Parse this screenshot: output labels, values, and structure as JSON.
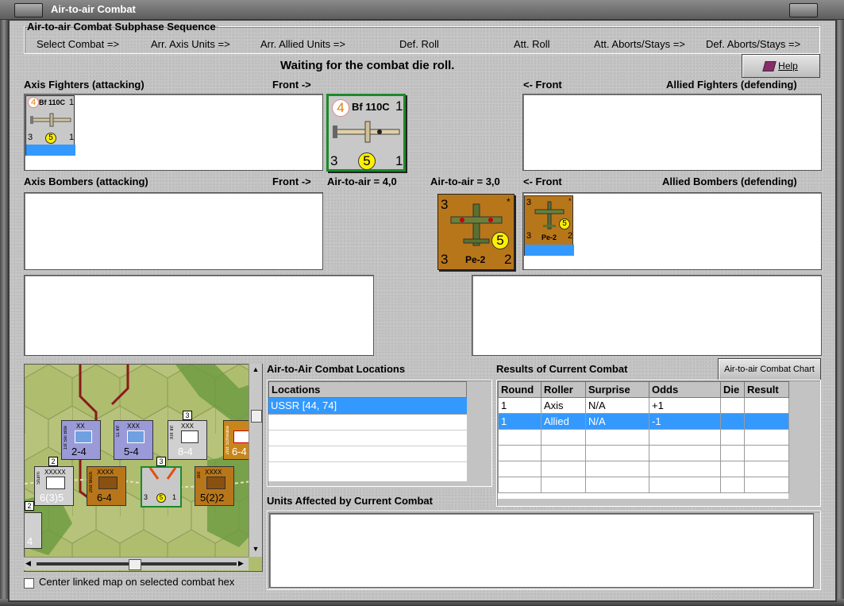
{
  "window": {
    "title": "Air-to-air Combat"
  },
  "sequence": {
    "title": "Air-to-air Combat Subphase Sequence",
    "steps": [
      "Select Combat =>",
      "Arr. Axis Units =>",
      "Arr. Allied Units =>",
      "Def. Roll",
      "Att. Roll",
      "Att. Aborts/Stays =>",
      "Def. Aborts/Stays =>"
    ]
  },
  "status_message": "Waiting for the combat die roll.",
  "help_label": "Help",
  "axis_fighters": {
    "label": "Axis Fighters (attacking)",
    "front": "Front ->"
  },
  "allied_fighters": {
    "label": "Allied Fighters (defending)",
    "front": "<- Front"
  },
  "axis_bombers": {
    "label": "Axis Bombers (attacking)",
    "front": "Front ->",
    "air_to_air": "Air-to-air = 4,0"
  },
  "allied_bombers": {
    "label": "Allied Bombers (defending)",
    "front": "<- Front",
    "air_to_air": "Air-to-air = 3,0"
  },
  "bf110": {
    "name": "Bf 110C",
    "top_left": "4",
    "top_right": "1",
    "bottom_left": "3",
    "bottom_center": "5",
    "bottom_right": "1"
  },
  "pe2": {
    "name": "Pe-2",
    "top_left": "3",
    "star": "*",
    "center": "5",
    "bottom_left": "3",
    "bottom_right": "2"
  },
  "locations": {
    "title": "Air-to-Air Combat Locations",
    "header": "Locations",
    "rows": [
      "USSR [44, 74]"
    ]
  },
  "results": {
    "title": "Results of Current Combat",
    "chart_button": "Air-to-air Combat Chart",
    "columns": [
      "Round",
      "Roller",
      "Surprise",
      "Odds",
      "Die",
      "Result"
    ],
    "rows": [
      [
        "1",
        "Axis",
        "N/A",
        "+1",
        "",
        ""
      ],
      [
        "1",
        "Allied",
        "N/A",
        "-1",
        "",
        ""
      ]
    ]
  },
  "units_affected": {
    "title": "Units Affected by Current Combat"
  },
  "center_map": {
    "label": "Center linked map on selected combat hex"
  },
  "map_units": [
    {
      "type": "XX",
      "name": "1st Ski Bde",
      "value": "2-4"
    },
    {
      "type": "XXX",
      "name": "11 Inf",
      "value": "5-4"
    },
    {
      "type": "XXX",
      "name": "XIII Inf",
      "value": "8-4"
    },
    {
      "type": "",
      "name": "2nd Schwabe",
      "value": "6-4"
    },
    {
      "type": "XXXXX",
      "name": "Sturm",
      "value": "6(3)5"
    },
    {
      "type": "XXXX",
      "name": "2nd Mech",
      "value": "6-4"
    },
    {
      "type": "XXXX",
      "name": "3rd",
      "value": "5(2)2"
    },
    {
      "type": "",
      "name": "",
      "value": "4"
    }
  ],
  "map_badges": [
    "2",
    "3",
    "3",
    "2"
  ],
  "colors": {
    "selection": "#3399ff",
    "fighter_border": "#1a8a2a",
    "bomber_bg": "#b8761a",
    "counter_gray": "#c8c8c8"
  }
}
